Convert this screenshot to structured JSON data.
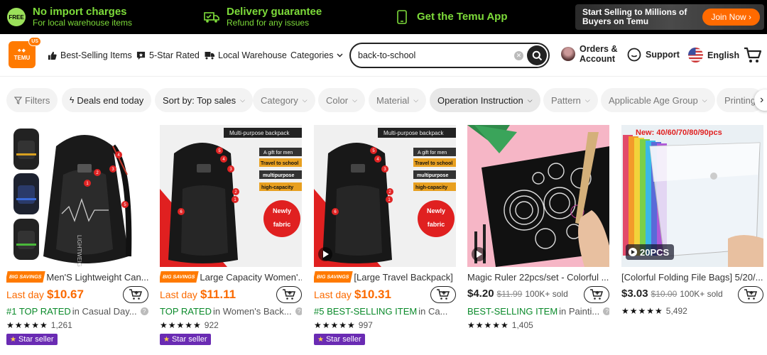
{
  "promo": {
    "free_badge": "FREE",
    "no_import_title": "No import charges",
    "no_import_sub": "For local warehouse items",
    "delivery_title": "Delivery guarantee",
    "delivery_sub": "Refund for any issues",
    "app_title": "Get the Temu App",
    "seller_text": "Start Selling to Millions of Buyers on Temu",
    "join_label": "Join Now ›",
    "accent_color": "#7ddb3a"
  },
  "header": {
    "logo_text": "TEMU",
    "logo_region": "US",
    "nav": [
      "Best-Selling Items",
      "5-Star Rated",
      "Local Warehouse",
      "Categories"
    ],
    "search_value": "back-to-school",
    "account_line1": "Orders &",
    "account_line2": "Account",
    "support": "Support",
    "language": "English",
    "brand_color": "#ff7a00"
  },
  "filters": [
    "Filters",
    "Deals end today",
    "Sort by: Top sales",
    "Category",
    "Color",
    "Material",
    "Operation Instruction",
    "Pattern",
    "Applicable Age Group",
    "Printing"
  ],
  "products": [
    {
      "badge": "BIG SAVINGS",
      "title": "Men'S Lightweight Can...",
      "price_prefix": "Last day",
      "price": "$10.67",
      "rank_highlight": "#1 TOP RATED",
      "rank_rest": " in Casual Day...",
      "stars": "★★★★★",
      "reviews": "1,261",
      "seller": "Star seller"
    },
    {
      "badge": "BIG SAVINGS",
      "title": "Large Capacity Women'...",
      "price_prefix": "Last day",
      "price": "$11.11",
      "rank_highlight": "TOP RATED",
      "rank_rest": " in Women's Back...",
      "stars": "★★★★★",
      "reviews": "922",
      "seller": "Star seller",
      "img_caption": "Multi-purpose backpack",
      "img_tags": [
        "A gift for men",
        "Travel to school",
        "multipurpose",
        "high-capacity"
      ],
      "img_badge": "Newly fabric"
    },
    {
      "badge": "BIG SAVINGS",
      "title": "[Large Travel Backpack] ...",
      "price_prefix": "Last day",
      "price": "$10.31",
      "rank_highlight": "#5 BEST-SELLING ITEM",
      "rank_rest": " in Ca...",
      "stars": "★★★★★",
      "reviews": "997",
      "seller": "Star seller",
      "img_caption": "Multi-purpose backpack",
      "img_tags": [
        "A gift for men",
        "Travel to school",
        "multipurpose",
        "high-capacity"
      ],
      "img_badge": "Newly fabric"
    },
    {
      "title": "Magic Ruler 22pcs/set - Colorful ...",
      "price": "$4.20",
      "old_price": "$11.99",
      "sold": "100K+ sold",
      "rank_highlight": "BEST-SELLING ITEM",
      "rank_rest": " in Painti...",
      "stars": "★★★★★",
      "reviews": "1,405"
    },
    {
      "title": "[Colorful Folding File Bags] 5/20/...",
      "price": "$3.03",
      "old_price": "$10.00",
      "sold": "100K+ sold",
      "stars": "★★★★★",
      "reviews": "5,492",
      "img_caption": "New: 40/60/70/80/90pcs",
      "img_badge": "20PCS"
    }
  ]
}
